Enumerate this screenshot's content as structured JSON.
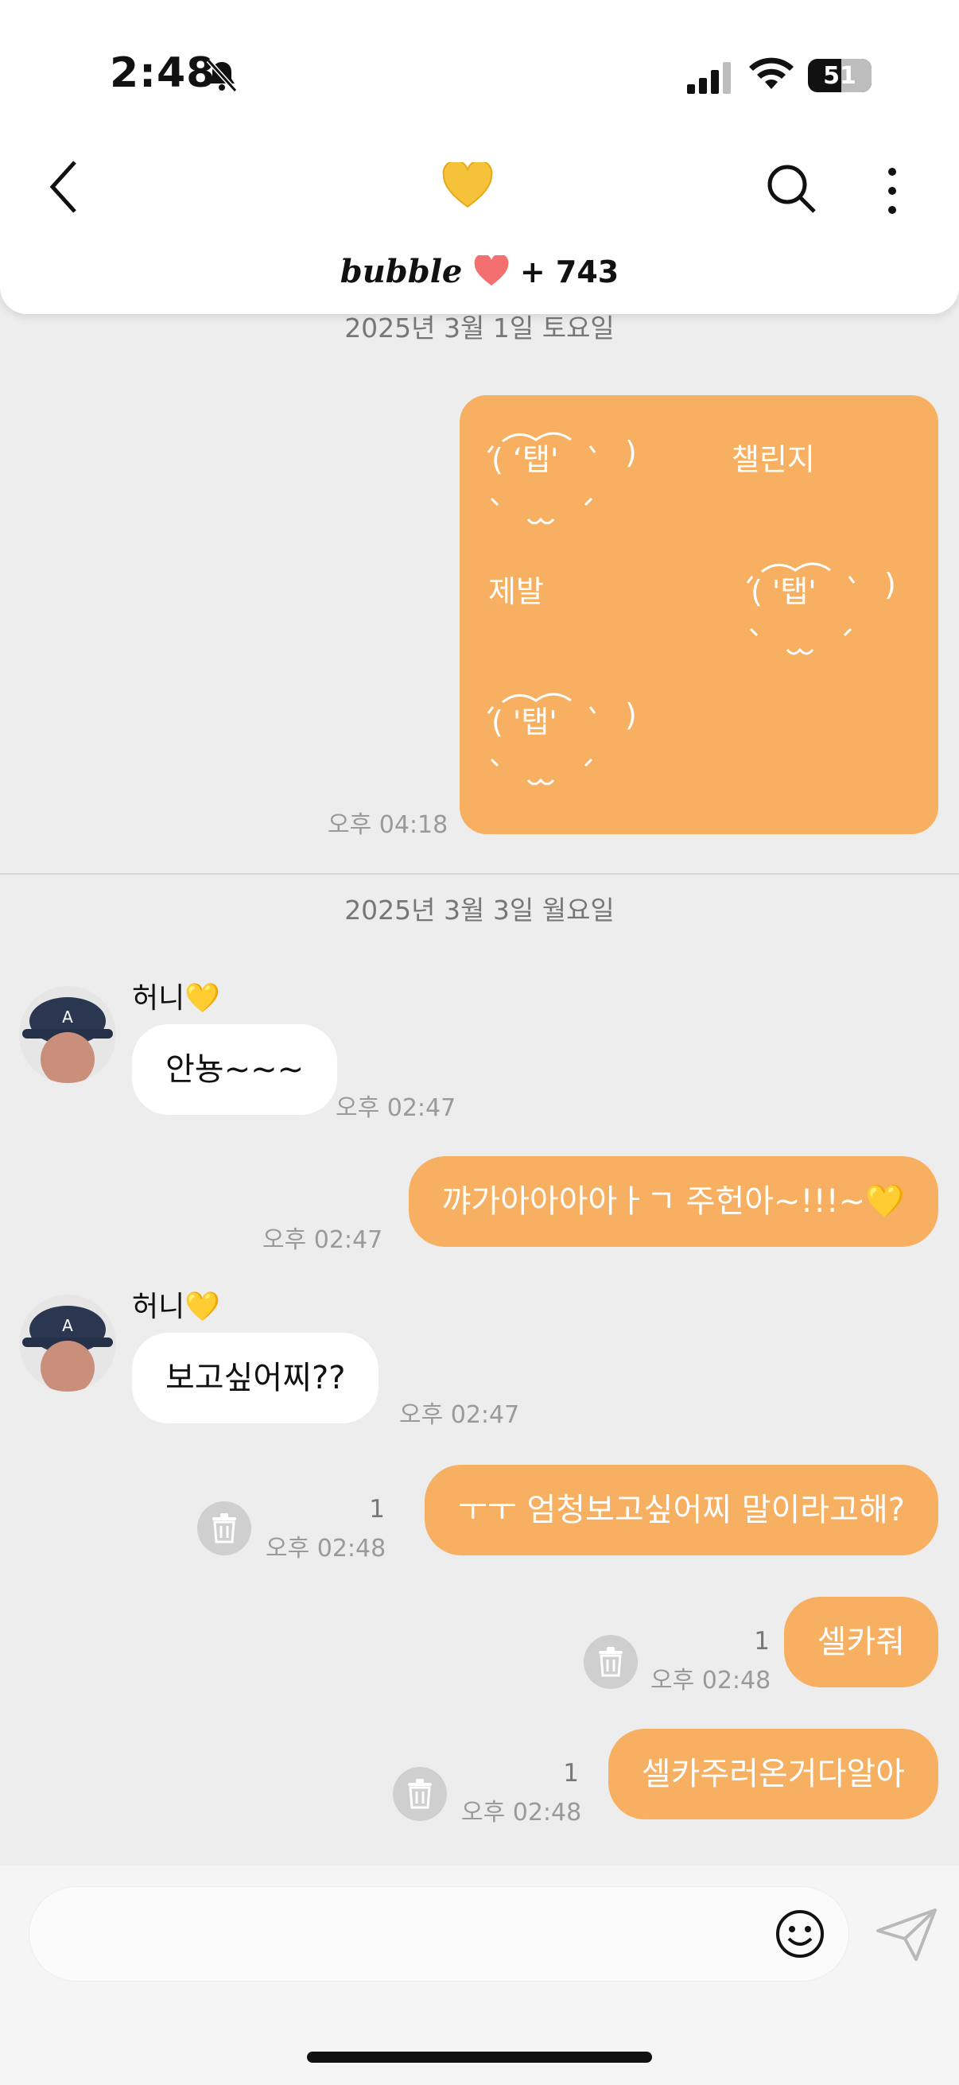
{
  "status_bar": {
    "time": "2:48",
    "battery": "51"
  },
  "header": {
    "title_icon": "yellow-heart-icon",
    "brand_name": "bubble",
    "brand_icon": "pink-heart-icon",
    "follower_count": "+ 743"
  },
  "dates": {
    "first": "2025년 3월 1일 토요일",
    "second": "2025년 3월 3일 월요일"
  },
  "sticker_message": {
    "lines": [
      "( ‘탭'",
      ")",
      "챌린지",
      "제발",
      "( '탭'",
      ")",
      "( '탭'",
      ")"
    ],
    "time": "오후 04:18"
  },
  "messages": [
    {
      "sender": "허니💛",
      "text": "안뇽~~~",
      "time": "오후 02:47"
    },
    {
      "text": "꺄가아아아아ㅏㄱ 주헌아~!!!~💛",
      "time": "오후 02:47"
    },
    {
      "sender": "허니💛",
      "text": "보고싶어찌??",
      "time": "오후 02:47"
    },
    {
      "text": "ㅜㅜ 엄청보고싶어찌 말이라고해?",
      "time": "오후 02:48",
      "unread": "1"
    },
    {
      "text": "셀카줘",
      "time": "오후 02:48",
      "unread": "1"
    },
    {
      "text": "셀카주러온거다알아",
      "time": "오후 02:48",
      "unread": "1"
    }
  ],
  "compose": {
    "placeholder": ""
  },
  "colors": {
    "outgoing_bubble": "#f7b062",
    "incoming_bubble": "#ffffff",
    "background": "#ededed"
  }
}
